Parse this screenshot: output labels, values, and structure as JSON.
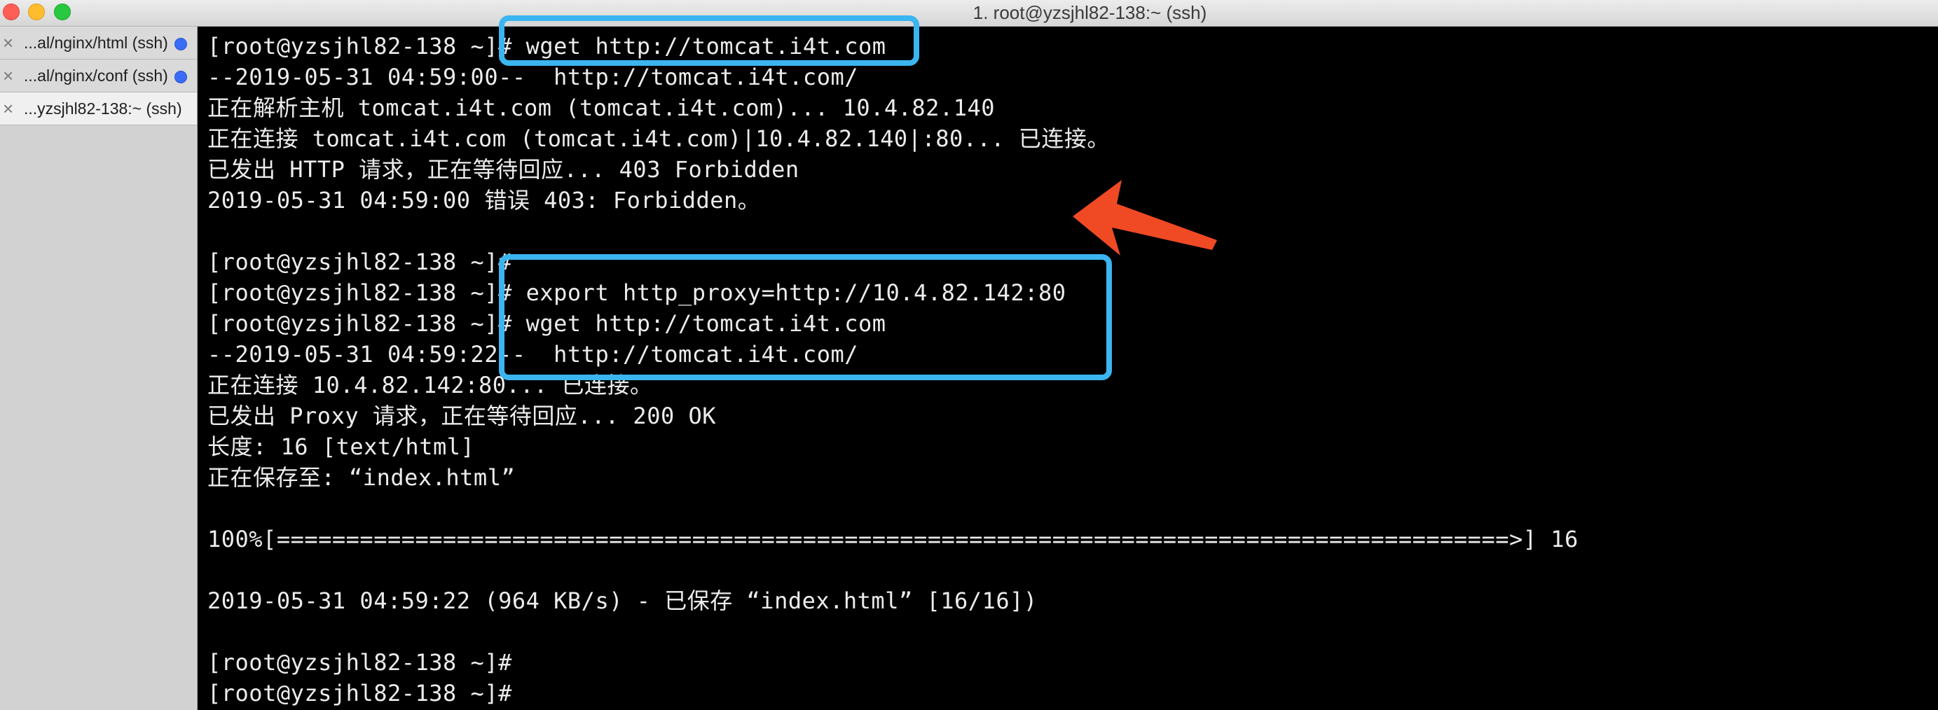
{
  "window": {
    "title": "1. root@yzsjhl82-138:~ (ssh)"
  },
  "tabs": [
    {
      "label": "...al/nginx/html (ssh)",
      "has_activity": true,
      "close_icon": "close-icon"
    },
    {
      "label": "...al/nginx/conf (ssh)",
      "has_activity": true,
      "close_icon": "close-icon"
    },
    {
      "label": "...yzsjhl82-138:~ (ssh)",
      "has_activity": false,
      "close_icon": "close-icon"
    }
  ],
  "terminal": {
    "lines": [
      "[root@yzsjhl82-138 ~]# wget http://tomcat.i4t.com",
      "--2019-05-31 04:59:00--  http://tomcat.i4t.com/",
      "正在解析主机 tomcat.i4t.com (tomcat.i4t.com)... 10.4.82.140",
      "正在连接 tomcat.i4t.com (tomcat.i4t.com)|10.4.82.140|:80... 已连接。",
      "已发出 HTTP 请求，正在等待回应... 403 Forbidden",
      "2019-05-31 04:59:00 错误 403: Forbidden。",
      "",
      "[root@yzsjhl82-138 ~]#",
      "[root@yzsjhl82-138 ~]# export http_proxy=http://10.4.82.142:80",
      "[root@yzsjhl82-138 ~]# wget http://tomcat.i4t.com",
      "--2019-05-31 04:59:22--  http://tomcat.i4t.com/",
      "正在连接 10.4.82.142:80... 已连接。",
      "已发出 Proxy 请求，正在等待回应... 200 OK",
      "长度: 16 [text/html]",
      "正在保存至: “index.html”",
      "",
      "100%[=========================================================================================>] 16",
      "",
      "2019-05-31 04:59:22 (964 KB/s) - 已保存 “index.html” [16/16])",
      "",
      "[root@yzsjhl82-138 ~]#",
      "[root@yzsjhl82-138 ~]#"
    ]
  },
  "colors": {
    "highlight_box": "#3bb5f0",
    "arrow": "#f04a25",
    "activity_dot": "#3b6cf5"
  }
}
